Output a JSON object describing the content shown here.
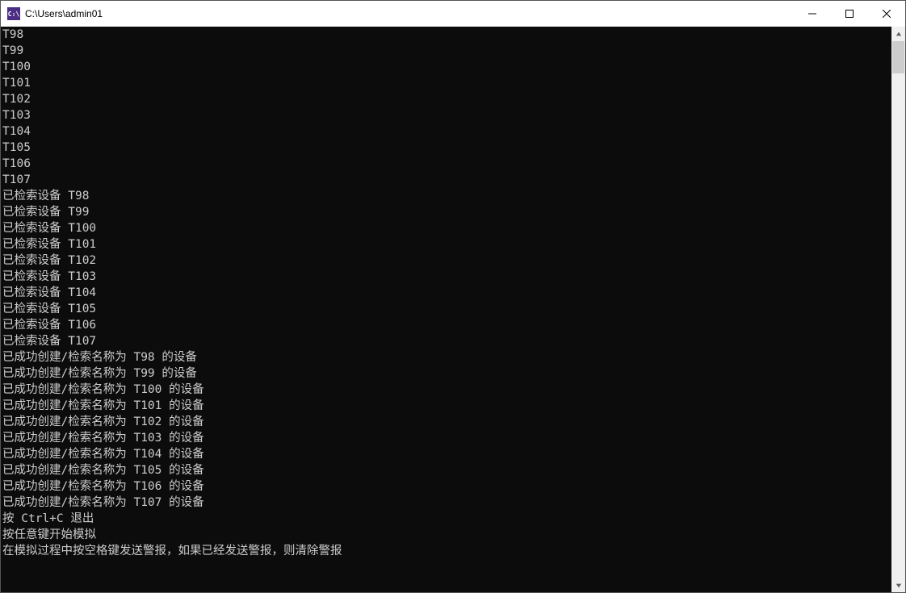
{
  "titlebar": {
    "icon_text": "C:\\",
    "title": "C:\\Users\\admin01"
  },
  "console": {
    "lines": [
      "T98",
      "T99",
      "T100",
      "T101",
      "T102",
      "T103",
      "T104",
      "T105",
      "T106",
      "T107",
      "已检索设备 T98",
      "已检索设备 T99",
      "已检索设备 T100",
      "已检索设备 T101",
      "已检索设备 T102",
      "已检索设备 T103",
      "已检索设备 T104",
      "已检索设备 T105",
      "已检索设备 T106",
      "已检索设备 T107",
      "已成功创建/检索名称为 T98 的设备",
      "已成功创建/检索名称为 T99 的设备",
      "已成功创建/检索名称为 T100 的设备",
      "已成功创建/检索名称为 T101 的设备",
      "已成功创建/检索名称为 T102 的设备",
      "已成功创建/检索名称为 T103 的设备",
      "已成功创建/检索名称为 T104 的设备",
      "已成功创建/检索名称为 T105 的设备",
      "已成功创建/检索名称为 T106 的设备",
      "已成功创建/检索名称为 T107 的设备",
      "按 Ctrl+C 退出",
      "按任意键开始模拟",
      "在模拟过程中按空格键发送警报，如果已经发送警报，则清除警报"
    ]
  }
}
